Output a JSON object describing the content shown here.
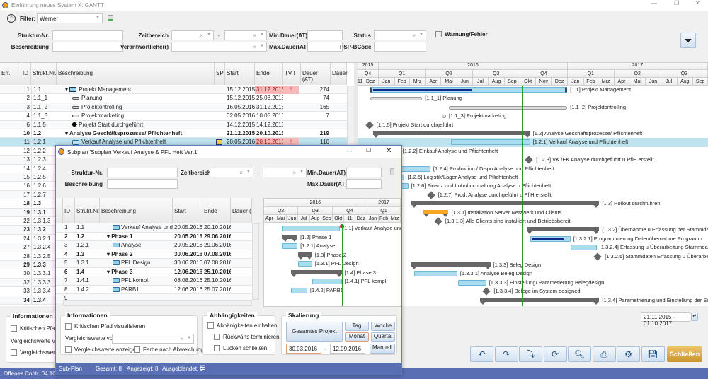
{
  "window": {
    "title": "Einführung neues System X: GANTT"
  },
  "filter": {
    "label": "Filter:",
    "value": "Werner",
    "struktur_label": "Struktur-Nr.",
    "beschreibung_label": "Beschreibung",
    "zeitbereich_label": "Zeitbereich",
    "verantwortliche_label": "Verantwortliche(r)",
    "min_dauer_label": "Min.Dauer(AT)",
    "max_dauer_label": "Max.Dauer(AT)",
    "status_label": "Status",
    "psp_label": "PSP-BCode",
    "warnung_label": "Warnung/Fehler",
    "dash": "-"
  },
  "table": {
    "headers": [
      "Err.",
      "ID",
      "Strukt.Nr.",
      "Beschreibung",
      "SP",
      "Start",
      "Ende",
      "TV !",
      "Dauer (AT)",
      "Dauer"
    ],
    "rows": [
      {
        "id": "1",
        "nr": "1.1",
        "desc": "Projekt Management",
        "start": "15.12.2015",
        "end": "31.12.2016",
        "tv": "!",
        "dauer": "274",
        "icon": "box",
        "lvl": 1,
        "tri": true,
        "endred": true,
        "g": {
          "type": "task",
          "s": "15.12.2015",
          "e": "31.12.2016",
          "progress": 0.5
        }
      },
      {
        "id": "2",
        "nr": "1.1_1",
        "desc": "Planung",
        "start": "15.12.2015",
        "end": "25.03.2016",
        "dauer": "74",
        "icon": "pill",
        "lvl": 2,
        "g": {
          "type": "pill",
          "s": "15.12.2015",
          "e": "25.03.2016"
        }
      },
      {
        "id": "3",
        "nr": "1.1_2",
        "desc": "Projektontrolling",
        "start": "16.05.2016",
        "end": "31.12.2016",
        "dauer": "165",
        "icon": "pill",
        "lvl": 2,
        "g": {
          "type": "pill",
          "s": "16.05.2016",
          "e": "31.12.2016"
        }
      },
      {
        "id": "4",
        "nr": "1.1_3",
        "desc": "Projektmarketing",
        "start": "02.05.2016",
        "end": "10.05.2016",
        "dauer": "7",
        "icon": "pill",
        "lvl": 2,
        "g": {
          "type": "pill",
          "s": "02.05.2016",
          "e": "10.05.2016"
        }
      },
      {
        "id": "6",
        "nr": "1.1.5",
        "desc": "Projekt Start durchgeführt",
        "start": "14.12.2015",
        "end": "14.12.2015",
        "icon": "diamond",
        "lvl": 2,
        "g": {
          "type": "ms",
          "s": "14.12.2015"
        }
      },
      {
        "id": "10",
        "nr": "1.2",
        "desc": "Analyse Geschäftsprozesse/ Pflichtenheft",
        "start": "21.12.2015",
        "end": "20.10.2016",
        "dauer": "219",
        "bold": true,
        "lvl": 1,
        "tri": true,
        "g": {
          "type": "sum",
          "s": "21.12.2015",
          "e": "20.10.2016"
        }
      },
      {
        "id": "11",
        "nr": "1.2.1",
        "desc": "Verkauf Analyse und Pflichtenheft",
        "start": "20.05.2016",
        "end": "20.10.2016",
        "tv": "!",
        "dauer": "110",
        "icon": "task",
        "lvl": 2,
        "sel": true,
        "endred": true,
        "sp": true,
        "g": {
          "type": "task",
          "s": "20.05.2016",
          "e": "20.10.2016"
        }
      },
      {
        "id": "12",
        "nr": "1.2.2",
        "desc": "Einkauf Analyse und Pflichtenheft",
        "lvl": 2,
        "g": {
          "type": "task",
          "s": "20.12.2015",
          "e": "11.02.2016"
        }
      },
      {
        "id": "13",
        "nr": "1.2.3",
        "desc": "VK /EK Analyse durchgeführt u PflH erstellt",
        "lvl": 2,
        "g": {
          "type": "ms",
          "s": "18.10.2016"
        }
      },
      {
        "id": "14",
        "nr": "1.2.4",
        "desc": "Produktion / Dispo Analyse und Pflichtenheft",
        "lvl": 2,
        "g": {
          "type": "task",
          "s": "10.02.2016",
          "e": "10.04.2016"
        }
      },
      {
        "id": "15",
        "nr": "1.2.5",
        "desc": "Logistik/Lager Analyse und Pflichtenheft",
        "lvl": 2,
        "g": {
          "type": "task",
          "s": "10.01.2016",
          "e": "20.02.2016"
        }
      },
      {
        "id": "16",
        "nr": "1.2.6",
        "desc": "Finanz und Lohnbuchhaltung Analyse u Pflichtenheft",
        "lvl": 2,
        "g": {
          "type": "task",
          "s": "10.01.2016",
          "e": "27.02.2016"
        }
      },
      {
        "id": "17",
        "nr": "1.2.7",
        "desc": "Prod. Analyse durchgeführt u PflH erstellt",
        "lvl": 2,
        "g": {
          "type": "ms",
          "s": "11.04.2016"
        }
      },
      {
        "id": "18",
        "nr": "1.3",
        "desc": "Rollout durchführen",
        "bold": true,
        "lvl": 1,
        "g": {
          "type": "sum",
          "s": "04.03.2016",
          "e": "03.03.2017"
        }
      },
      {
        "id": "19",
        "nr": "1.3.1",
        "desc": "Installation Server Netzwerk und Clients",
        "bold": true,
        "lvl": 2,
        "g": {
          "type": "sumo",
          "s": "27.03.2016",
          "e": "15.05.2016"
        }
      },
      {
        "id": "22",
        "nr": "1.3.1.3",
        "desc": "Alle Clients sind installiert und Betriebsbereit",
        "lvl": 3,
        "g": {
          "type": "ms",
          "s": "25.04.2016"
        }
      },
      {
        "id": "23",
        "nr": "1.3.2",
        "desc": "Übernahme u Erfassung der Stammdaten",
        "bold": true,
        "lvl": 2,
        "g": {
          "type": "sum",
          "s": "14.10.2016",
          "e": "03.03.2017"
        }
      },
      {
        "id": "24",
        "nr": "1.3.2.1",
        "desc": "Programmierung Datenübernahme Programm",
        "lvl": 3,
        "g": {
          "type": "task",
          "s": "20.10.2016",
          "e": "06.01.2017",
          "progress": 0.8
        }
      },
      {
        "id": "27",
        "nr": "1.3.2.4",
        "desc": "Erfassung u Überarbeitung Stammdaten",
        "lvl": 3,
        "g": {
          "type": "task",
          "s": "07.01.2017",
          "e": "26.02.2017"
        }
      },
      {
        "id": "28",
        "nr": "1.3.2.5",
        "desc": "Stammdaten Erfassung u Überarbeitung",
        "lvl": 3,
        "g": {
          "type": "ms",
          "s": "28.02.2017"
        }
      },
      {
        "id": "29",
        "nr": "1.3.3",
        "desc": "Beleg Design",
        "bold": true,
        "lvl": 2,
        "g": {
          "type": "sum",
          "s": "04.03.2016",
          "e": "04.08.2016"
        }
      },
      {
        "id": "30",
        "nr": "1.3.3.1",
        "desc": "Analyse Beleg Design",
        "lvl": 3,
        "g": {
          "type": "task",
          "s": "09.03.2016",
          "e": "01.06.2016"
        }
      },
      {
        "id": "32",
        "nr": "1.3.3.3",
        "desc": "Einstellung/ Parametierung Belegdesign",
        "lvl": 3,
        "g": {
          "type": "task",
          "s": "03.06.2016",
          "e": "27.07.2016"
        }
      },
      {
        "id": "33",
        "nr": "1.3.3.4",
        "desc": "Belege  im System designed",
        "lvl": 3,
        "g": {
          "type": "ms",
          "s": "28.07.2016"
        }
      },
      {
        "id": "34",
        "nr": "1.3.4",
        "desc": "Parametrierung und Einstellung der Software",
        "bold": true,
        "lvl": 2,
        "g": {
          "type": "sum",
          "s": "15.07.2016",
          "e": "03.03.2017"
        }
      }
    ]
  },
  "gantt": {
    "today": "04.10.2016",
    "years": [
      {
        "label": "2015",
        "from": "01.10.2015",
        "to": "31.12.2015"
      },
      {
        "label": "2016",
        "from": "01.01.2016",
        "to": "31.12.2016"
      },
      {
        "label": "2017",
        "from": "01.01.2017",
        "to": "30.09.2017"
      }
    ],
    "quarters": [
      "Q4",
      "Q1",
      "Q2",
      "Q3",
      "Q4",
      "Q1",
      "Q2",
      "Q3"
    ],
    "months": [
      "11",
      "Dez",
      "Jan",
      "Feb",
      "Mrz",
      "Apr",
      "Mai",
      "Jun",
      "Jul",
      "Aug",
      "Sep",
      "Okt",
      "Nov",
      "Dez",
      "Jan",
      "Feb",
      "Mrz",
      "Apr",
      "Mai",
      "Jun",
      "Jul",
      "Aug",
      "Sep"
    ],
    "range": "21.11.2015 - 01.10.2017"
  },
  "bottom": {
    "info_title": "Informationen",
    "krit": "Kritischen Pfad visualisieren",
    "vgl_von": "Vergleichswerte von",
    "vgl_anz": "Vergleichswerte anzeigen",
    "close": "Schließen",
    "status": "Offenes Contr. 04.10.2016",
    "tool_icons": [
      "undo-icon",
      "redo-icon",
      "dependency-icon",
      "refresh-icon",
      "preview-icon",
      "print-icon",
      "settings-icon",
      "save-icon"
    ]
  },
  "sub": {
    "title": "Subplan 'Subplan Verkauf Analyse & PFL Heft Var.1'",
    "headers": [
      "ID",
      "Strukt.Nr.",
      "Beschreibung",
      "Start",
      "Ende",
      "Dauer (AT)"
    ],
    "today": "25.10.2016",
    "rows": [
      {
        "id": "1",
        "nr": "1.1",
        "desc": "Verkauf Analyse und Pflichtenheft",
        "start": "20.05.2016",
        "end": "20.10.2016",
        "lvl": 2,
        "g": {
          "type": "task",
          "s": "20.05.2016",
          "e": "20.10.2016",
          "warn": true
        }
      },
      {
        "id": "2",
        "nr": "1.2",
        "desc": "Phase 1",
        "start": "20.05.2016",
        "end": "29.06.2016",
        "bold": true,
        "lvl": 1,
        "g": {
          "type": "sum",
          "s": "20.05.2016",
          "e": "29.06.2016"
        }
      },
      {
        "id": "3",
        "nr": "1.2.1",
        "desc": "Analyse",
        "start": "20.05.2016",
        "end": "29.06.2016",
        "lvl": 2,
        "g": {
          "type": "task",
          "s": "20.05.2016",
          "e": "29.06.2016"
        }
      },
      {
        "id": "4",
        "nr": "1.3",
        "desc": "Phase 2",
        "start": "30.06.2016",
        "end": "07.08.2016",
        "bold": true,
        "lvl": 1,
        "g": {
          "type": "sum",
          "s": "30.06.2016",
          "e": "07.08.2016"
        }
      },
      {
        "id": "5",
        "nr": "1.3.1",
        "desc": "PFL Design",
        "start": "30.06.2016",
        "end": "07.08.2016",
        "lvl": 2,
        "g": {
          "type": "task",
          "s": "30.06.2016",
          "e": "07.08.2016"
        }
      },
      {
        "id": "6",
        "nr": "1.4",
        "desc": "Phase 3",
        "start": "12.06.2016",
        "end": "25.10.2016",
        "bold": true,
        "lvl": 1,
        "g": {
          "type": "sum",
          "s": "12.06.2016",
          "e": "25.10.2016"
        }
      },
      {
        "id": "7",
        "nr": "1.4.1",
        "desc": "PFL kompl.",
        "start": "08.08.2016",
        "end": "25.10.2016",
        "lvl": 2,
        "g": {
          "type": "task",
          "s": "08.08.2016",
          "e": "25.10.2016"
        }
      },
      {
        "id": "8",
        "nr": "1.4.2",
        "desc": "PARB1",
        "start": "12.06.2016",
        "end": "25.07.2016",
        "lvl": 2,
        "g": {
          "type": "task",
          "s": "12.06.2016",
          "e": "25.07.2016"
        }
      },
      {
        "id": "9",
        "nr": "",
        "desc": "",
        "lvl": 1
      }
    ],
    "gantt_labels": [
      "[1.1] Verkauf Analyse und Pflichtenheft",
      "[1.2] Phase 1",
      "[1.2.1] Analyse",
      "[1.3] Phase 2",
      "[1.3.1] PFL Design",
      "[1.4] Phase 3",
      "[1.4.1] PFL kompl.",
      "[1.4.2] PARB1"
    ],
    "years": [
      {
        "label": "2016",
        "from": "01.04.2016",
        "to": "31.12.2016"
      },
      {
        "label": "2017",
        "from": "01.01.2017",
        "to": "31.03.2017"
      }
    ],
    "quarters": [
      "Q2",
      "Q3",
      "Q4",
      "Q1",
      "Q2"
    ],
    "months": [
      "Apr",
      "Mai",
      "Jun",
      "Jul",
      "Aug",
      "Sep",
      "Okt",
      "11",
      "Dez",
      "Jan",
      "Feb",
      "Mrz",
      "Q4"
    ],
    "info": {
      "title": "Informationen",
      "krit": "Kritischen Pfad visualisieren",
      "vgl_von": "Vergleichswerte von",
      "vgl_anz": "Vergleichswerte anzeigen",
      "farbe": "Farbe nach Abweichung"
    },
    "abh": {
      "title": "Abhängigkeiten",
      "einhalten": "Abhänigkeiten einhalten",
      "rueck": "Rückwärts terminieren",
      "luecken": "Lücken schließen"
    },
    "skal": {
      "title": "Skalierung",
      "gesamt": "Gesamtes Projekt",
      "tag": "Tag",
      "woche": "Woche",
      "monat": "Monat",
      "quartal": "Quartal",
      "from": "30.03.2016",
      "to": "12.09.2016",
      "manuell": "Manuell"
    },
    "status": {
      "plan": "Sub-Plan",
      "gesamt": "Gesamt: 8",
      "angezeigt": "Angezeigt: 8",
      "ausgeblendet": "Ausgeblendet: 0"
    }
  }
}
